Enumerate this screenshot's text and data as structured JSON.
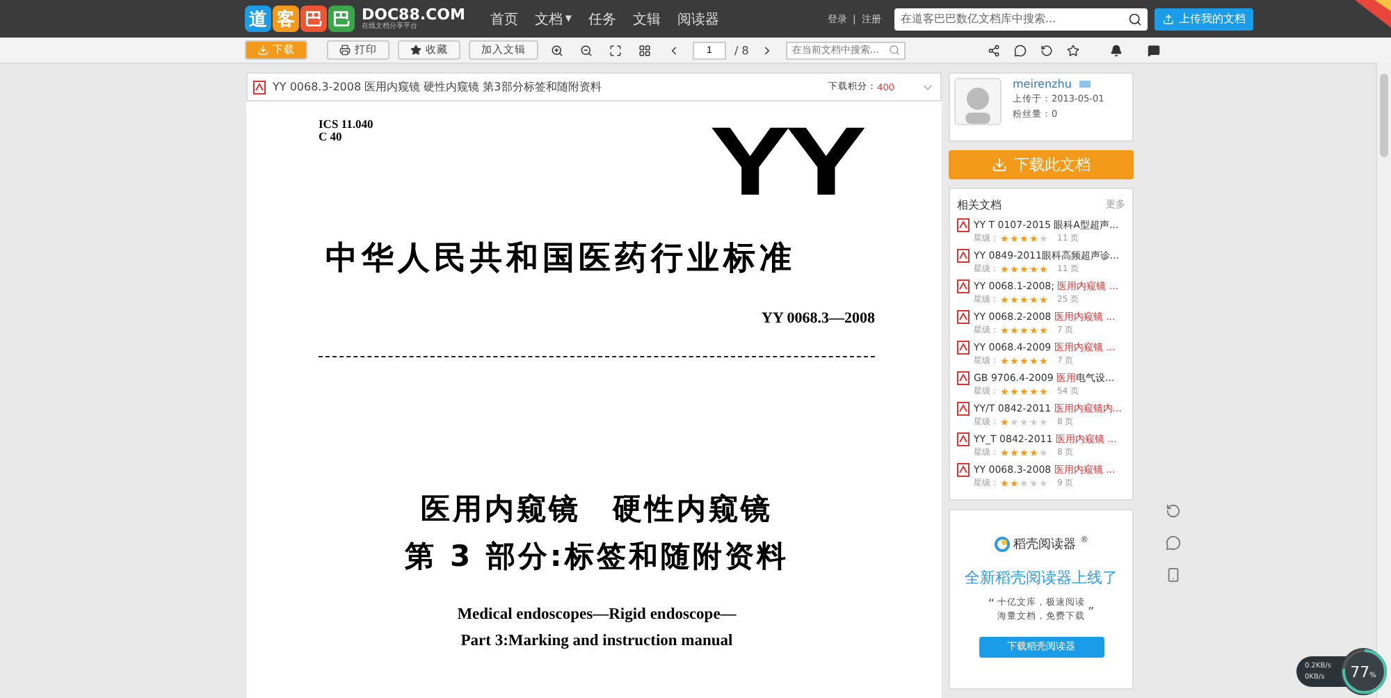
{
  "topbar": {
    "logo_chars": [
      "道",
      "客",
      "巴",
      "巴"
    ],
    "site": "DOC88.COM",
    "slogan": "在线文档分享平台",
    "nav": [
      {
        "label": "首页"
      },
      {
        "label": "文档",
        "caret": "▼"
      },
      {
        "label": "任务"
      },
      {
        "label": "文辑"
      },
      {
        "label": "阅读器"
      }
    ],
    "login": "登录",
    "separator": "|",
    "register": "注册",
    "search_placeholder": "在道客巴巴数亿文档库中搜索...",
    "upload": "上传我的文档"
  },
  "toolbar": {
    "download": "下载",
    "print": "打印",
    "favorite": "收藏",
    "add_collection": "加入文辑",
    "page": "1",
    "total": "/ 8",
    "search_placeholder": "在当前文档中搜索..."
  },
  "document": {
    "title": "YY 0068.3-2008 医用内窥镜 硬性内窥镜 第3部分标签和随附资料",
    "points_label": "下载积分：",
    "points": "400",
    "page": {
      "ics": "ICS 11.040",
      "class": "C 40",
      "mark": "YY",
      "standard": "中华人民共和国医药行业标准",
      "number": "YY 0068.3—2008",
      "title_lines": [
        "医用内窥镜　硬性内窥镜",
        "第 3 部分:标签和随附资料"
      ],
      "english_lines": [
        "Medical endoscopes—Rigid endoscope—",
        "Part 3:Marking and instruction manual"
      ]
    }
  },
  "uploader": {
    "name": "meirenzhu",
    "uploaded": "上传于：2013-05-01",
    "fans": "粉丝量：0"
  },
  "download_button": "下载此文档",
  "related": {
    "title": "相关文档",
    "more": "更多",
    "items": [
      {
        "parts": [
          {
            "text": "YY T 0107-2015 眼科A型超声...",
            "highlight": false
          }
        ],
        "rating_label": "星级：",
        "stars": 4,
        "pages": "11 页"
      },
      {
        "parts": [
          {
            "text": "YY 0849-2011眼科高频超声诊...",
            "highlight": false
          }
        ],
        "rating_label": "星级：",
        "stars": 5,
        "pages": "11 页"
      },
      {
        "parts": [
          {
            "text": "YY 0068.1-2008; ",
            "highlight": false
          },
          {
            "text": "医用内窥镜 ...",
            "highlight": true
          }
        ],
        "rating_label": "星级：",
        "stars": 5,
        "pages": "25 页"
      },
      {
        "parts": [
          {
            "text": "YY 0068.2-2008 ",
            "highlight": false
          },
          {
            "text": "医用内窥镜 ...",
            "highlight": true
          }
        ],
        "rating_label": "星级：",
        "stars": 5,
        "pages": "7 页"
      },
      {
        "parts": [
          {
            "text": "YY 0068.4-2009 ",
            "highlight": false
          },
          {
            "text": "医用内窥镜 ...",
            "highlight": true
          }
        ],
        "rating_label": "星级：",
        "stars": 5,
        "pages": "7 页"
      },
      {
        "parts": [
          {
            "text": "GB 9706.4-2009 ",
            "highlight": false
          },
          {
            "text": "医用",
            "highlight": true
          },
          {
            "text": "电气设...",
            "highlight": false
          }
        ],
        "rating_label": "星级：",
        "stars": 5,
        "pages": "54 页"
      },
      {
        "parts": [
          {
            "text": "YY/T 0842-2011 ",
            "highlight": false
          },
          {
            "text": "医用内窥镜内...",
            "highlight": true
          }
        ],
        "rating_label": "星级：",
        "stars": 1,
        "pages": "8 页"
      },
      {
        "parts": [
          {
            "text": "YY_T 0842-2011 ",
            "highlight": false
          },
          {
            "text": "医用内窥镜 ...",
            "highlight": true
          }
        ],
        "rating_label": "星级：",
        "stars": 4,
        "pages": "8 页"
      },
      {
        "parts": [
          {
            "text": "YY 0068.3-2008 ",
            "highlight": false
          },
          {
            "text": "医用内窥镜 ...",
            "highlight": true
          }
        ],
        "rating_label": "星级：",
        "stars": 2,
        "pages": "9 页"
      }
    ]
  },
  "ad": {
    "brand": "稻壳阅读器",
    "registered": "®",
    "headline": "全新稻壳阅读器上线了",
    "quote_open": "“",
    "quote_lines": [
      "十亿文库，极速阅读",
      "海量文档，免费下载"
    ],
    "quote_close": "”",
    "button": "下载稻壳阅读器"
  },
  "speed_widget": {
    "up": "0.2KB/s",
    "down": "0KB/s",
    "percent": "77",
    "unit": "%",
    "level": 0.77
  }
}
